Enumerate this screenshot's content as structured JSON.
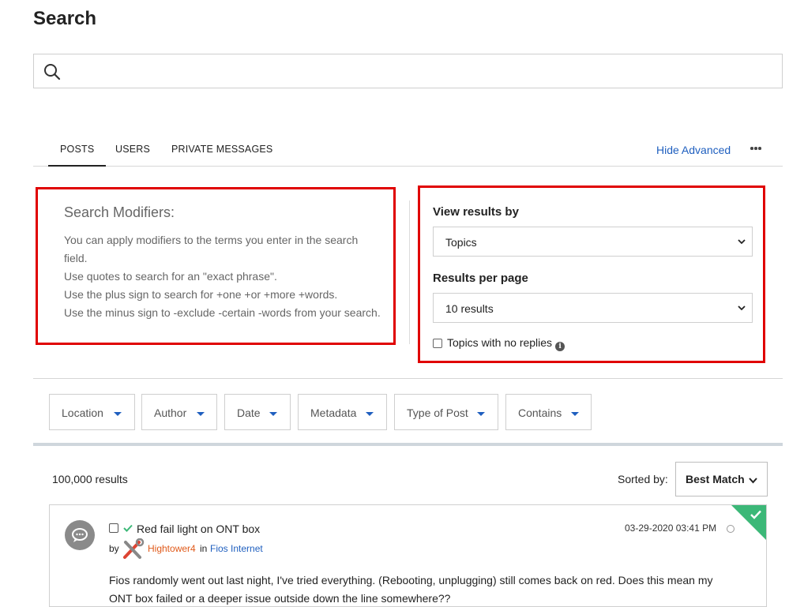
{
  "page": {
    "title": "Search"
  },
  "search": {
    "placeholder": "",
    "value": ""
  },
  "tabs": [
    {
      "label": "POSTS",
      "active": true
    },
    {
      "label": "USERS",
      "active": false
    },
    {
      "label": "PRIVATE MESSAGES",
      "active": false
    }
  ],
  "header_actions": {
    "hide_advanced": "Hide Advanced",
    "more_icon": "ellipsis-icon"
  },
  "modifiers": {
    "title": "Search Modifiers:",
    "lines": [
      "You can apply modifiers to the terms you enter in the search",
      "field.",
      "Use quotes to search for an \"exact phrase\".",
      "Use the plus sign to search for +one +or +more +words.",
      "Use the minus sign to -exclude -certain -words from your search."
    ]
  },
  "view_options": {
    "view_by_label": "View results by",
    "view_by_value": "Topics",
    "per_page_label": "Results per page",
    "per_page_value": "10 results",
    "no_replies_label": "Topics with no replies",
    "no_replies_checked": false
  },
  "filters": [
    "Location",
    "Author",
    "Date",
    "Metadata",
    "Type of Post",
    "Contains"
  ],
  "results": {
    "count": "100,000 results",
    "sorted_by_label": "Sorted by:",
    "sort_value": "Best Match"
  },
  "posts": [
    {
      "subject": "Red fail light on ONT box",
      "by": "by",
      "author": "Hightower4",
      "in": "in",
      "board": "Fios Internet",
      "date": "03-29-2020 03:41 PM",
      "solved": true,
      "body": "Fios randomly went out last night, I've tried everything. (Rebooting, unplugging) still comes back on red. Does this mean my ONT box failed or a deeper issue outside down the line somewhere??"
    }
  ],
  "colors": {
    "accent": "#1f5fbf",
    "highlight_box": "#e00000",
    "solved": "#3cb878",
    "author": "#e05a1a"
  }
}
